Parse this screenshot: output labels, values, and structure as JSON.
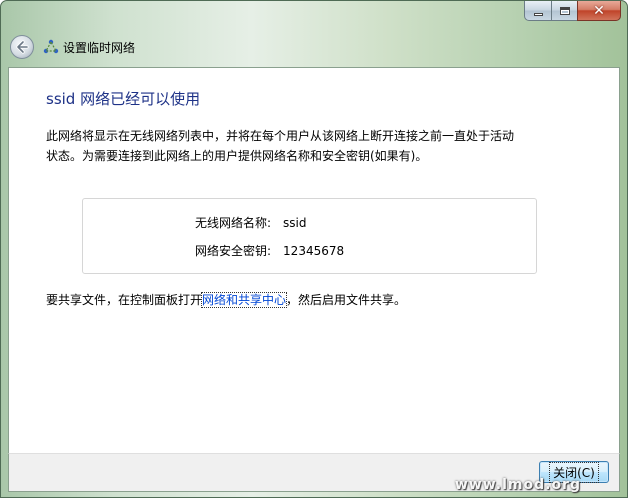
{
  "window": {
    "title": "设置临时网络"
  },
  "content": {
    "heading": "ssid 网络已经可以使用",
    "description_line1": "此网络将显示在无线网络列表中，并将在每个用户从该网络上断开连接之前一直处于活动",
    "description_line2": "状态。为需要连接到此网络上的用户提供网络名称和安全密钥(如果有)。",
    "network_name_label": "无线网络名称:",
    "network_name_value": "ssid",
    "security_key_label": "网络安全密钥:",
    "security_key_value": "12345678",
    "share_prefix": "要共享文件，在控制面板打开",
    "share_link": "网络和共享中心",
    "share_suffix": "，然后启用文件共享。"
  },
  "footer": {
    "close_label": "关闭(C)"
  },
  "watermark": "www.lmod.org",
  "icons": {
    "back": "back-arrow-icon",
    "wizard": "adhoc-network-icon",
    "minimize": "minimize-icon",
    "maximize": "maximize-icon",
    "close": "close-icon"
  },
  "colors": {
    "heading": "#1e3287",
    "link": "#0046d5"
  }
}
